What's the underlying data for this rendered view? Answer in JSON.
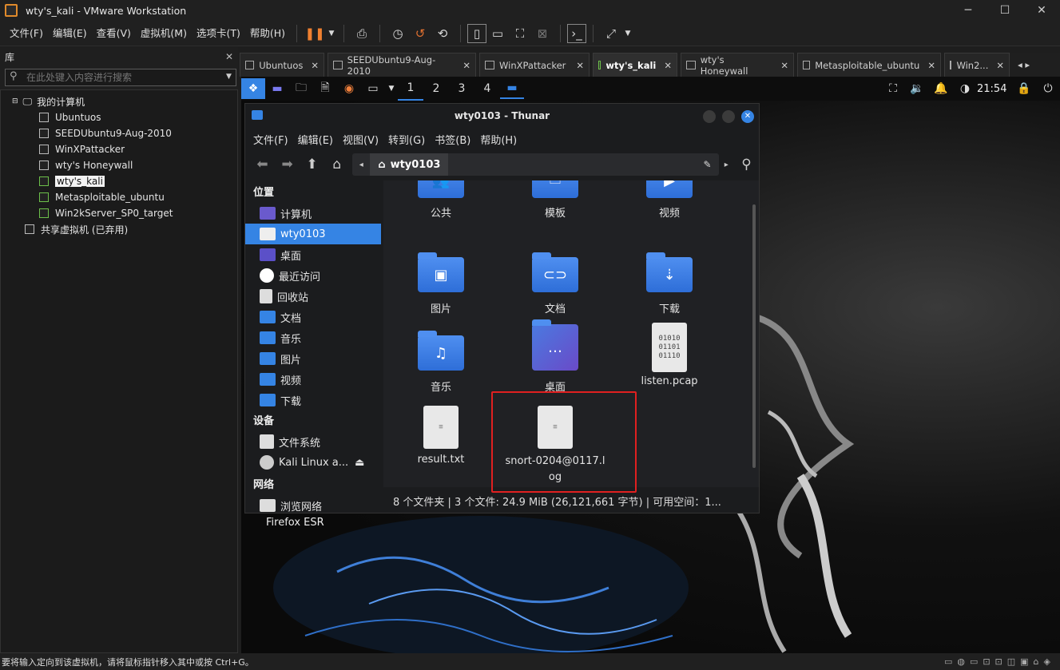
{
  "window": {
    "title": "wty's_kali - VMware Workstation",
    "minimize": "─",
    "maximize": "☐",
    "close": "✕"
  },
  "menu": [
    "文件(F)",
    "编辑(E)",
    "查看(V)",
    "虚拟机(M)",
    "选项卡(T)",
    "帮助(H)"
  ],
  "library": {
    "title": "库",
    "close": "✕",
    "search_placeholder": "在此处键入内容进行搜索",
    "root": "我的计算机",
    "vms": [
      "Ubuntuos",
      "SEEDUbuntu9-Aug-2010",
      "WinXPattacker",
      "wty's Honeywall",
      "wty's_kali",
      "Metasploitable_ubuntu",
      "Win2kServer_SP0_target"
    ],
    "selected": "wty's_kali",
    "shared": "共享虚拟机 (已弃用)"
  },
  "tabs": [
    {
      "label": "Ubuntuos",
      "active": false
    },
    {
      "label": "SEEDUbuntu9-Aug-2010",
      "active": false
    },
    {
      "label": "WinXPattacker",
      "active": false
    },
    {
      "label": "wty's_kali",
      "active": true
    },
    {
      "label": "wty's Honeywall",
      "active": false
    },
    {
      "label": "Metasploitable_ubuntu",
      "active": false
    },
    {
      "label": "Win2...",
      "active": false
    }
  ],
  "kali_panel": {
    "workspaces": [
      "1",
      "2",
      "3",
      "4"
    ],
    "time": "21:54"
  },
  "thunar": {
    "title": "wty0103 - Thunar",
    "menu": [
      "文件(F)",
      "编辑(E)",
      "视图(V)",
      "转到(G)",
      "书签(B)",
      "帮助(H)"
    ],
    "path": "wty0103",
    "sidebar": {
      "places_header": "位置",
      "places": [
        "计算机",
        "wty0103",
        "桌面",
        "最近访问",
        "回收站",
        "文档",
        "音乐",
        "图片",
        "视频",
        "下载"
      ],
      "devices_header": "设备",
      "devices": [
        "文件系统",
        "Kali Linux a..."
      ],
      "network_header": "网络",
      "network": [
        "浏览网络"
      ]
    },
    "files": [
      {
        "name": "公共",
        "icon": "group-icon"
      },
      {
        "name": "模板",
        "icon": "template-icon"
      },
      {
        "name": "视频",
        "icon": "video-icon"
      },
      {
        "name": "图片",
        "icon": "image-icon"
      },
      {
        "name": "文档",
        "icon": "document-icon"
      },
      {
        "name": "下载",
        "icon": "download-icon"
      },
      {
        "name": "音乐",
        "icon": "music-icon"
      },
      {
        "name": "桌面",
        "icon": "desktop-icon"
      },
      {
        "name": "listen.pcap",
        "icon": "binary-file-icon",
        "preview": "01010\n01101\n01110"
      },
      {
        "name": "result.txt",
        "icon": "text-file-icon"
      },
      {
        "name": "snort-0204@0117.log",
        "name_line1": "snort-0204@0117.l",
        "name_line2": "og",
        "icon": "text-file-icon"
      }
    ],
    "status": "8 个文件夹 | 3 个文件: 24.9 MiB (26,121,661 字节) | 可用空间：1..."
  },
  "desktop": {
    "firefox_label": "Firefox ESR"
  },
  "status_bar": {
    "text": "要将输入定向到该虚拟机，请将鼠标指针移入其中或按 Ctrl+G。"
  },
  "colors": {
    "accent": "#3584e4",
    "highlight_box": "#e02020"
  }
}
